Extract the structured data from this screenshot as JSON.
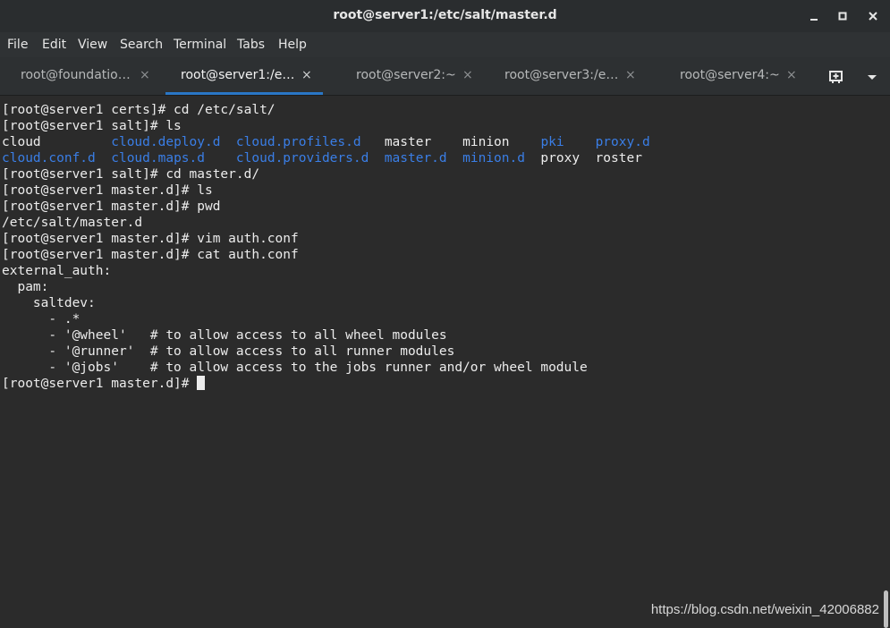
{
  "window": {
    "title": "root@server1:/etc/salt/master.d",
    "minimize": "_",
    "maximize": "□",
    "close": "✕"
  },
  "menu": [
    "File",
    "Edit",
    "View",
    "Search",
    "Terminal",
    "Tabs",
    "Help"
  ],
  "tabs": [
    {
      "label": "root@foundatio…",
      "close": "×"
    },
    {
      "label": "root@server1:/e…",
      "close": "×"
    },
    {
      "label": "root@server2:~",
      "close": "×"
    },
    {
      "label": "root@server3:/e…",
      "close": "×"
    },
    {
      "label": "root@server4:~",
      "close": "×"
    }
  ],
  "tab_actions": {
    "new_tab_icon": "new-tab-icon",
    "menu_icon": "chevron-down-icon"
  },
  "terminal": {
    "lines": [
      "[root@server1 certs]# cd /etc/salt/",
      "[root@server1 salt]# ls"
    ],
    "ls_row1": [
      "cloud",
      "cloud.deploy.d",
      "cloud.profiles.d",
      "master",
      "minion",
      "pki",
      "proxy.d"
    ],
    "ls_row2": [
      "cloud.conf.d",
      "cloud.maps.d",
      "cloud.providers.d",
      "master.d",
      "minion.d",
      "proxy",
      "roster"
    ],
    "lines_after": [
      "[root@server1 salt]# cd master.d/",
      "[root@server1 master.d]# ls",
      "[root@server1 master.d]# pwd",
      "/etc/salt/master.d",
      "[root@server1 master.d]# vim auth.conf",
      "[root@server1 master.d]# cat auth.conf",
      "external_auth:",
      "  pam:",
      "    saltdev:",
      "      - .*",
      "      - '@wheel'   # to allow access to all wheel modules",
      "      - '@runner'  # to allow access to all runner modules",
      "      - '@jobs'    # to allow access to the jobs runner and/or wheel module"
    ],
    "prompt": "[root@server1 master.d]# "
  },
  "watermark": "https://blog.csdn.net/weixin_42006882",
  "colors": {
    "background": "#2b2b2b",
    "text": "#ececec",
    "directory": "#3a7ee6",
    "accent": "#2a76c6"
  }
}
